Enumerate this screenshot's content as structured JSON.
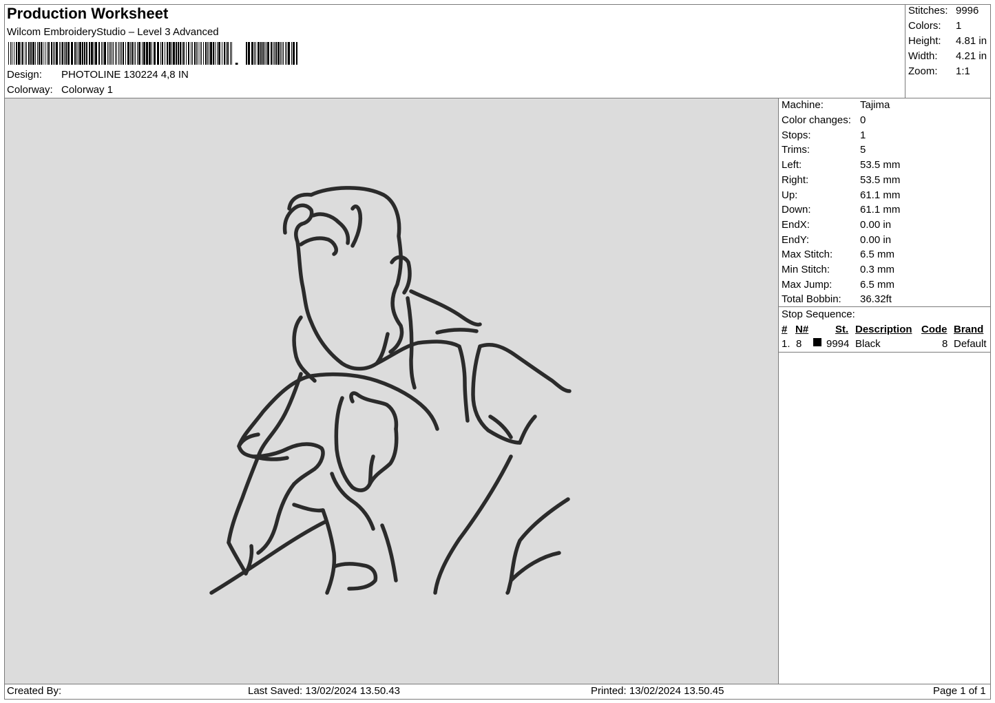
{
  "header": {
    "title": "Production Worksheet",
    "software": "Wilcom EmbroideryStudio – Level 3 Advanced",
    "design_label": "Design:",
    "design_value": "PHOTOLINE 130224 4,8 IN",
    "colorway_label": "Colorway:",
    "colorway_value": "Colorway 1"
  },
  "summary": [
    {
      "label": "Stitches:",
      "value": "9996"
    },
    {
      "label": "Colors:",
      "value": "1"
    },
    {
      "label": "Height:",
      "value": "4.81 in"
    },
    {
      "label": "Width:",
      "value": "4.21 in"
    },
    {
      "label": "Zoom:",
      "value": "1:1"
    }
  ],
  "machine_info": [
    {
      "label": "Machine:",
      "value": "Tajima"
    },
    {
      "label": "Color changes:",
      "value": "0"
    },
    {
      "label": "Stops:",
      "value": "1"
    },
    {
      "label": "Trims:",
      "value": "5"
    },
    {
      "label": "Left:",
      "value": "53.5 mm"
    },
    {
      "label": "Right:",
      "value": "53.5 mm"
    },
    {
      "label": "Up:",
      "value": "61.1 mm"
    },
    {
      "label": "Down:",
      "value": "61.1 mm"
    },
    {
      "label": "EndX:",
      "value": "0.00 in"
    },
    {
      "label": "EndY:",
      "value": "0.00 in"
    },
    {
      "label": "Max Stitch:",
      "value": "6.5 mm"
    },
    {
      "label": "Min Stitch:",
      "value": "0.3 mm"
    },
    {
      "label": "Max Jump:",
      "value": "6.5 mm"
    },
    {
      "label": "Total Bobbin:",
      "value": "36.32ft"
    }
  ],
  "stop_sequence": {
    "title": "Stop Sequence:",
    "headers": {
      "num": "#",
      "needle": "N#",
      "stitch": "St.",
      "description": "Description",
      "code": "Code",
      "brand": "Brand"
    },
    "rows": [
      {
        "num": "1.",
        "needle": "8",
        "swatch_color": "#000000",
        "stitch": "9994",
        "description": "Black",
        "code": "8",
        "brand": "Default"
      }
    ]
  },
  "design_preview": {
    "background": "#dcdcdc",
    "thread_color": "#2b2b2b"
  },
  "footer": {
    "created_by": "Created By:",
    "last_saved": "Last Saved: 13/02/2024 13.50.43",
    "printed": "Printed: 13/02/2024 13.50.45",
    "page": "Page 1 of 1"
  }
}
